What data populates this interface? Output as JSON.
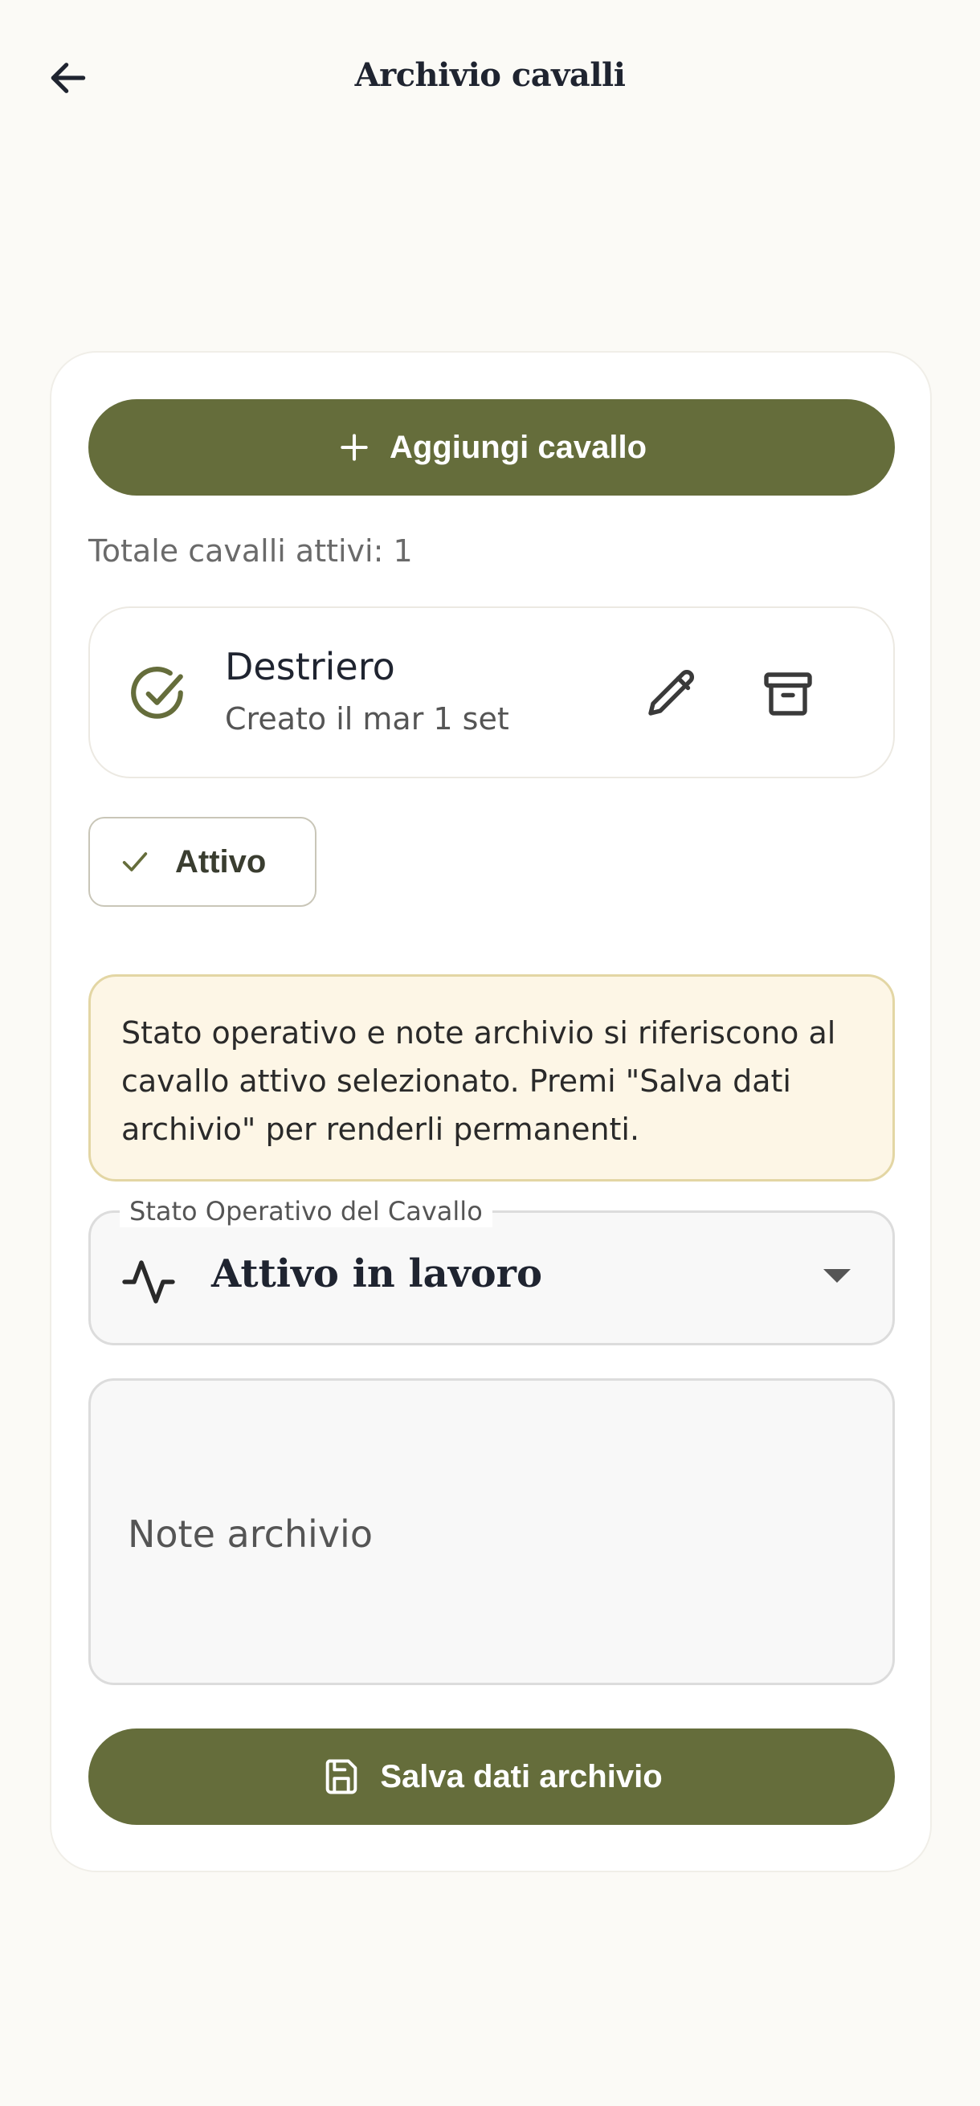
{
  "app_bar": {
    "title": "Archivio cavalli"
  },
  "actions": {
    "add_label": "Aggiungi cavallo",
    "save_label": "Salva dati archivio"
  },
  "summary": {
    "total_label": "Totale cavalli attivi: 1"
  },
  "horses": [
    {
      "name": "Destriero",
      "created": "Creato il mar 1 set"
    }
  ],
  "filter": {
    "label": "Attivo",
    "selected": true
  },
  "info": {
    "text": "Stato operativo e note archivio si riferiscono al cavallo attivo selezionato. Premi \"Salva dati archivio\" per renderli permanenti."
  },
  "status_field": {
    "label": "Stato Operativo del Cavallo",
    "value": "Attivo in lavoro"
  },
  "notes_field": {
    "placeholder": "Note archivio"
  },
  "icons": {
    "back": "arrow-left-icon",
    "add": "plus-icon",
    "check_circle": "check-circle-icon",
    "edit": "pencil-icon",
    "archive": "archive-box-icon",
    "check": "check-icon",
    "activity": "activity-icon",
    "dropdown": "caret-down-icon",
    "save": "floppy-disk-icon"
  },
  "colors": {
    "primary": "#656d3b",
    "background": "#fbfaf6",
    "info_bg": "#fdf6e6",
    "info_border": "#e3d6a4"
  }
}
